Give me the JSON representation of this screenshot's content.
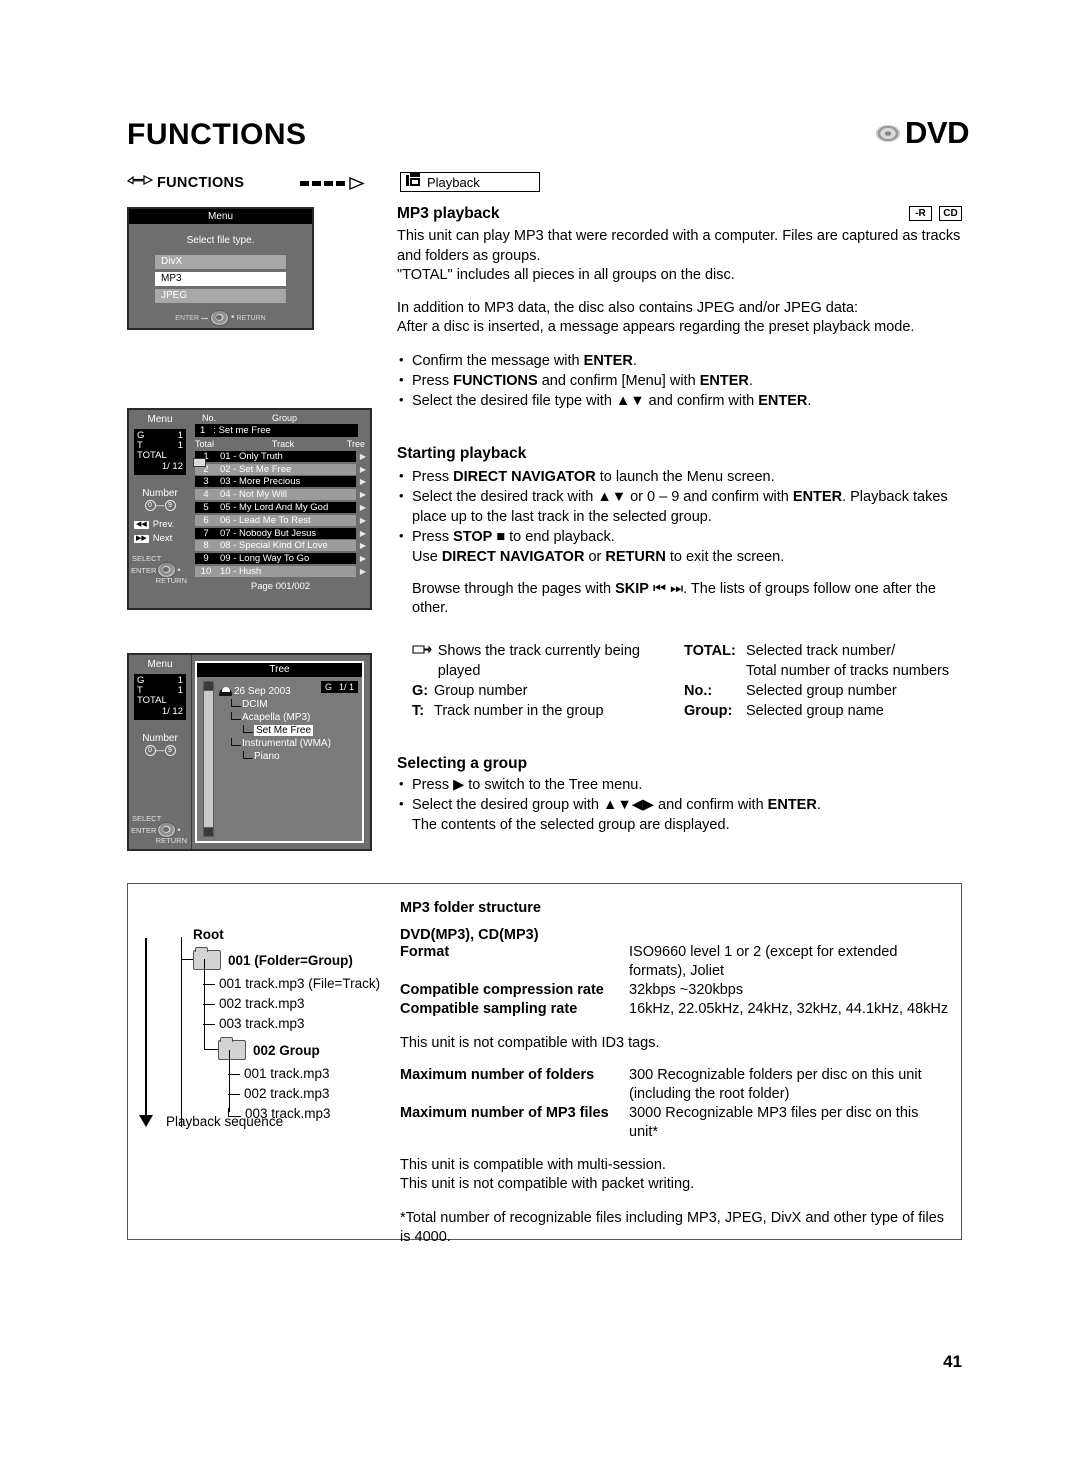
{
  "header": {
    "title": "FUNCTIONS",
    "logo_text": "DVD",
    "logo_icon": "dvd-disc-icon"
  },
  "nav": {
    "functions_label": "FUNCTIONS",
    "hand_icon": "pointing-hand-icon",
    "arrow_icon": "dashed-arrow-icon",
    "playback_tab": "Playback",
    "playback_tab_icon": "playback-filmstrip-icon"
  },
  "screens": {
    "filetype": {
      "title": "Menu",
      "subtitle": "Select file type.",
      "options": [
        "DivX",
        "MP3",
        "JPEG"
      ],
      "selected": "MP3",
      "nav_left": "ENTER",
      "nav_right": "RETURN"
    },
    "tracklist": {
      "menu_label": "Menu",
      "g_key": "G",
      "g_val": "1",
      "t_key": "T",
      "t_val": "1",
      "total_key": "TOTAL",
      "total_val": "1/ 12",
      "number_label": "Number",
      "num_from": "0",
      "num_dash": "—",
      "num_to": "9",
      "prev_label": "Prev.",
      "next_label": "Next",
      "prev_icon": "skip-back-icon",
      "next_icon": "skip-forward-icon",
      "select_label": "SELECT",
      "enter_label": "ENTER",
      "return_label": "RETURN",
      "col_no": "No.",
      "col_group": "Group",
      "group_no": "1",
      "group_name": ": Set me Free",
      "col_total": "Total",
      "col_track": "Track",
      "col_tree": "Tree",
      "rows": [
        {
          "no": "1",
          "name": "01 - Only Truth"
        },
        {
          "no": "2",
          "name": "02 - Set Me Free"
        },
        {
          "no": "3",
          "name": "03 - More Precious"
        },
        {
          "no": "4",
          "name": "04 - Not My Will"
        },
        {
          "no": "5",
          "name": "05 - My Lord And My God"
        },
        {
          "no": "6",
          "name": "06 - Lead Me To Rest"
        },
        {
          "no": "7",
          "name": "07 - Nobody But Jesus"
        },
        {
          "no": "8",
          "name": "08 - Special Kind Of Love"
        },
        {
          "no": "9",
          "name": "09 - Long Way To Go"
        },
        {
          "no": "10",
          "name": "10 - Hush"
        }
      ],
      "page": "Page 001/002"
    },
    "tree": {
      "menu_label": "Menu",
      "g_key": "G",
      "g_val": "1",
      "t_key": "T",
      "t_val": "1",
      "total_key": "TOTAL",
      "total_val": "1/ 12",
      "number_label": "Number",
      "num_from": "0",
      "num_dash": "—",
      "num_to": "9",
      "select_label": "SELECT",
      "enter_label": "ENTER",
      "return_label": "RETURN",
      "title": "Tree",
      "badge_g": "G",
      "badge_val": "1/ 1",
      "nodes": [
        {
          "label": "26 Sep 2003",
          "level": 0,
          "selected": false,
          "icon": "open-folder-icon"
        },
        {
          "label": "DCIM",
          "level": 1,
          "selected": false
        },
        {
          "label": "Acapella (MP3)",
          "level": 1,
          "selected": false
        },
        {
          "label": "Set Me Free",
          "level": 2,
          "selected": true
        },
        {
          "label": "Instrumental (WMA)",
          "level": 1,
          "selected": false
        },
        {
          "label": "Piano",
          "level": 2,
          "selected": false
        }
      ]
    }
  },
  "main": {
    "mp3_playback_heading": "MP3 playback",
    "badges": [
      "-R",
      "CD"
    ],
    "intro_p1": "This unit can play MP3 that were recorded with a computer. Files are captured as tracks and folders as groups.",
    "intro_p2": "\"TOTAL\" includes all pieces in all groups on the disc.",
    "intro_p3": "In addition to MP3 data, the disc also contains JPEG and/or JPEG data:",
    "intro_p4": "After a disc is inserted, a message appears regarding the preset playback mode.",
    "bullets_intro": [
      "Confirm the message with ENTER.",
      "Press FUNCTIONS and confirm [Menu] with ENTER.",
      "Select the desired file type with ▲▼ and confirm with ENTER."
    ],
    "starting_playback_heading": "Starting playback",
    "sp_b1": "Press DIRECT NAVIGATOR to launch the Menu screen.",
    "sp_b2": "Select the desired track with ▲▼ or 0 – 9 and confirm with ENTER. Playback takes place up to the last track in the selected group.",
    "sp_b3": "Press STOP ■ to end playback.",
    "sp_b3_cont": "Use DIRECT NAVIGATOR or RETURN to exit the screen.",
    "sp_browse": "Browse through the pages with SKIP ⏮ ⏭. The lists of groups follow one after the other.",
    "legend_left": [
      {
        "key": "hand-icon",
        "val": "Shows the track currently being played"
      },
      {
        "key": "G:",
        "val": "Group number"
      },
      {
        "key": "T:",
        "val": "Track number in the group"
      }
    ],
    "legend_right": [
      {
        "key": "TOTAL:",
        "val": "Selected track number/"
      },
      {
        "key": "",
        "val": "Total number of tracks numbers"
      },
      {
        "key": "No.:",
        "val": "Selected group number"
      },
      {
        "key": "Group:",
        "val": "Selected group name"
      }
    ],
    "selecting_group_heading": "Selecting a group",
    "sg_b1": "Press ▶ to switch to the Tree menu.",
    "sg_b2": "Select the desired group with ▲▼◀▶ and confirm with ENTER.",
    "sg_b2_cont": "The contents of the selected group are displayed."
  },
  "folder_diagram": {
    "root_label": "Root",
    "group1_name": "001 (Folder=Group)",
    "group1_files": [
      "001 track.mp3 (File=Track)",
      "002 track.mp3",
      "003 track.mp3"
    ],
    "group2_name": "002 Group",
    "group2_files": [
      "001 track.mp3",
      "002 track.mp3",
      "003 track.mp3"
    ],
    "sequence_label": "Playback sequence",
    "folder_icon": "folder-icon",
    "arrow_icon": "down-arrow-icon"
  },
  "spec": {
    "heading": "MP3 folder structure",
    "subheading": "DVD(MP3), CD(MP3)",
    "rows": [
      {
        "key": "Format",
        "val": "ISO9660 level 1 or 2 (except for extended formats), Joliet"
      },
      {
        "key": "Compatible compression rate",
        "val": "32kbps ~320kbps"
      },
      {
        "key": "Compatible sampling rate",
        "val": "16kHz, 22.05kHz, 24kHz, 32kHz, 44.1kHz, 48kHz"
      }
    ],
    "note_id3": "This unit is not compatible with ID3 tags.",
    "rows2": [
      {
        "key": "Maximum number of folders",
        "val": "300 Recognizable folders per disc on this unit (including the root folder)"
      },
      {
        "key": "Maximum number of MP3 files",
        "val": "3000 Recognizable MP3 files per disc on this unit*"
      }
    ],
    "note_multisession": "This unit is compatible with multi-session.",
    "note_packet": "This unit is not compatible with packet writing.",
    "footnote": "*Total number of recognizable files including MP3, JPEG, DivX and other type of files is 4000."
  },
  "footer": {
    "page_number": "41"
  }
}
